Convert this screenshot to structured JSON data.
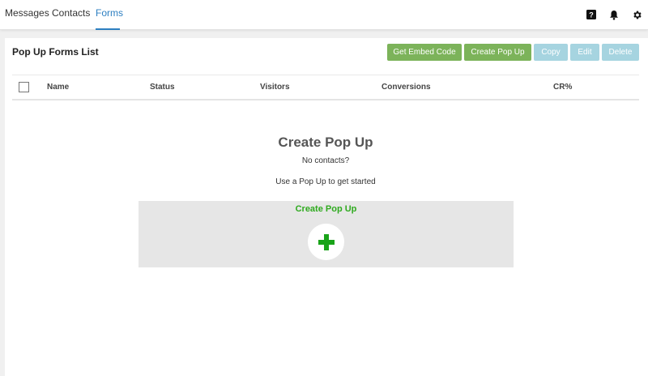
{
  "nav": {
    "tabs": [
      {
        "label": "Messages",
        "active": false
      },
      {
        "label": "Contacts",
        "active": false
      },
      {
        "label": "Forms",
        "active": true
      }
    ],
    "icons": [
      "help-icon",
      "bell-icon",
      "gear-icon"
    ],
    "accent_color": "#2d7fc1"
  },
  "panel": {
    "title": "Pop Up Forms List",
    "buttons": {
      "embed": "Get Embed Code",
      "create": "Create Pop Up",
      "copy": "Copy",
      "edit": "Edit",
      "delete": "Delete"
    },
    "button_colors": {
      "enabled": "#7cb35a",
      "disabled": "#a6d4e0"
    }
  },
  "table": {
    "columns": [
      "Name",
      "Status",
      "Visitors",
      "Conversions",
      "CR%"
    ],
    "rows": []
  },
  "empty_state": {
    "title": "Create Pop Up",
    "subtitle": "No contacts?",
    "hint": "Use a Pop Up to get started",
    "box_label": "Create Pop Up",
    "plus_color": "#19a319"
  }
}
